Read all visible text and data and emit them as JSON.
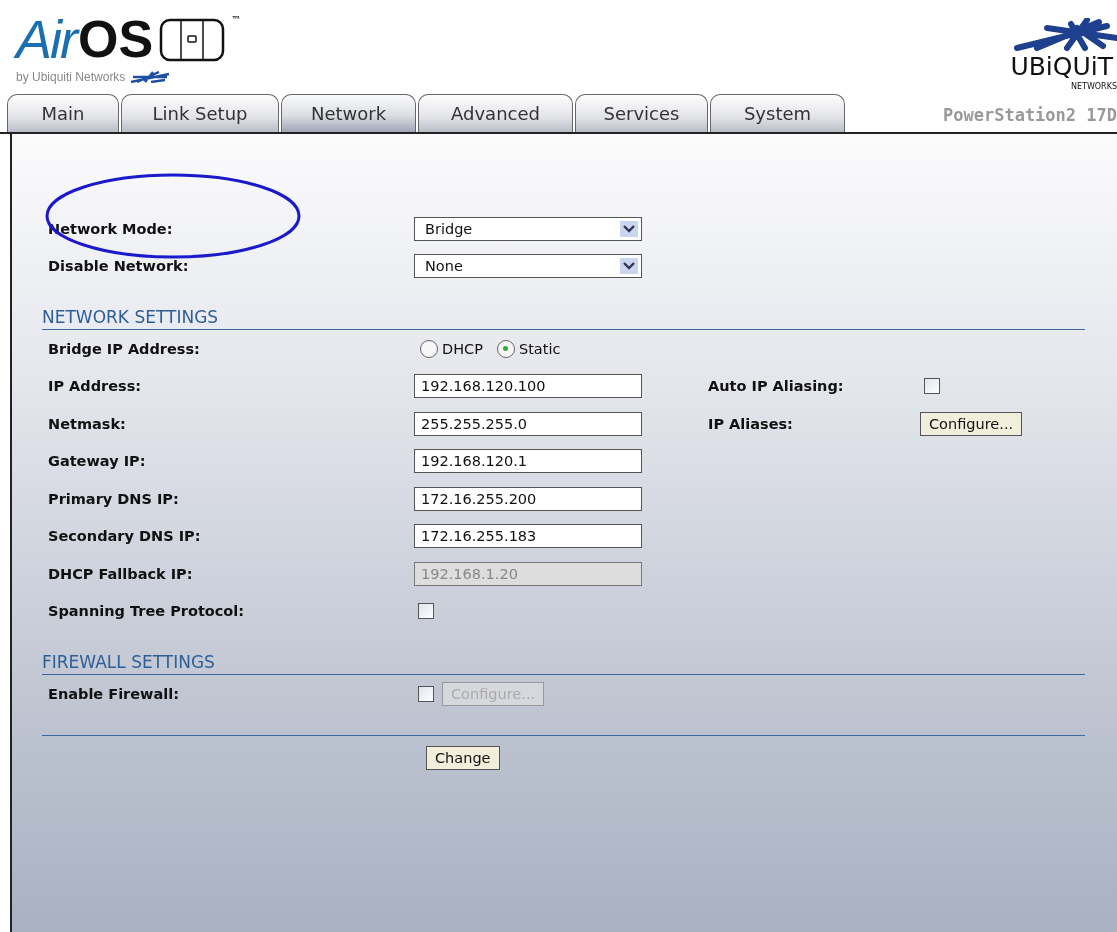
{
  "logo": {
    "air": "Air",
    "os": "OS",
    "tm": "™",
    "byline": "by Ubiquiti Networks"
  },
  "brand": {
    "name": "UBiQUiT",
    "sub": "NETWORKS"
  },
  "tabs": [
    {
      "label": "Main",
      "selected": false
    },
    {
      "label": "Link Setup",
      "selected": false
    },
    {
      "label": "Network",
      "selected": true
    },
    {
      "label": "Advanced",
      "selected": false
    },
    {
      "label": "Services",
      "selected": false
    },
    {
      "label": "System",
      "selected": false
    }
  ],
  "device_name": "PowerStation2 17D",
  "top_rows": [
    {
      "label": "Network Mode:",
      "kind": "select",
      "value": "Bridge",
      "circled": true
    },
    {
      "label": "Disable Network:",
      "kind": "select",
      "value": "None",
      "circled": false
    }
  ],
  "sections": [
    {
      "title": "NETWORK SETTINGS",
      "rows": [
        {
          "label": "Bridge IP Address:",
          "kind": "radio",
          "options": [
            {
              "label": "DHCP",
              "selected": false
            },
            {
              "label": "Static",
              "selected": true
            }
          ]
        },
        {
          "label": "IP Address:",
          "kind": "text",
          "value": "192.168.120.100",
          "disabled": false,
          "aside": {
            "label": "Auto IP Aliasing:",
            "kind": "checkbox",
            "checked": false
          }
        },
        {
          "label": "Netmask:",
          "kind": "text",
          "value": "255.255.255.0",
          "disabled": false,
          "aside": {
            "label": "IP Aliases:",
            "kind": "button",
            "button": "Configure...",
            "disabled": false
          }
        },
        {
          "label": "Gateway IP:",
          "kind": "text",
          "value": "192.168.120.1",
          "disabled": false
        },
        {
          "label": "Primary DNS IP:",
          "kind": "text",
          "value": "172.16.255.200",
          "disabled": false
        },
        {
          "label": "Secondary DNS IP:",
          "kind": "text",
          "value": "172.16.255.183",
          "disabled": false
        },
        {
          "label": "DHCP Fallback IP:",
          "kind": "text",
          "value": "192.168.1.20",
          "disabled": true
        },
        {
          "label": "Spanning Tree Protocol:",
          "kind": "checkbox",
          "checked": false
        }
      ]
    },
    {
      "title": "FIREWALL SETTINGS",
      "rows": [
        {
          "label": "Enable Firewall:",
          "kind": "checkbox",
          "checked": false,
          "button": "Configure...",
          "disabled": true
        }
      ]
    }
  ],
  "submit": "Change"
}
